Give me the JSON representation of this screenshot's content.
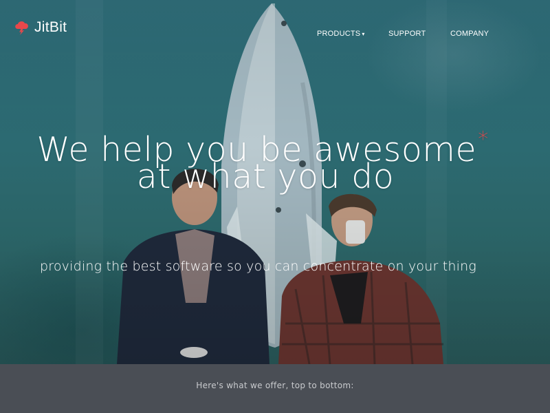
{
  "brand": {
    "name": "JitBit",
    "logo_icon": "cloud-bolt-icon",
    "accent": "#e8484b"
  },
  "nav": {
    "products": "PRODUCTS",
    "products_caret": "▾",
    "support": "SUPPORT",
    "company": "COMPANY"
  },
  "hero": {
    "headline_line1": "We help you be awesome",
    "headline_asterisk": "*",
    "headline_line2": "at what you do",
    "tagline": "providing the best software so you can concentrate on your thing"
  },
  "offer": {
    "text": "Here's what we offer, top to bottom:"
  },
  "colors": {
    "hero_bg": "#2e6b74",
    "bar_bg": "#4a4e55",
    "text": "#ffffff",
    "bar_text": "#c9cbce"
  }
}
